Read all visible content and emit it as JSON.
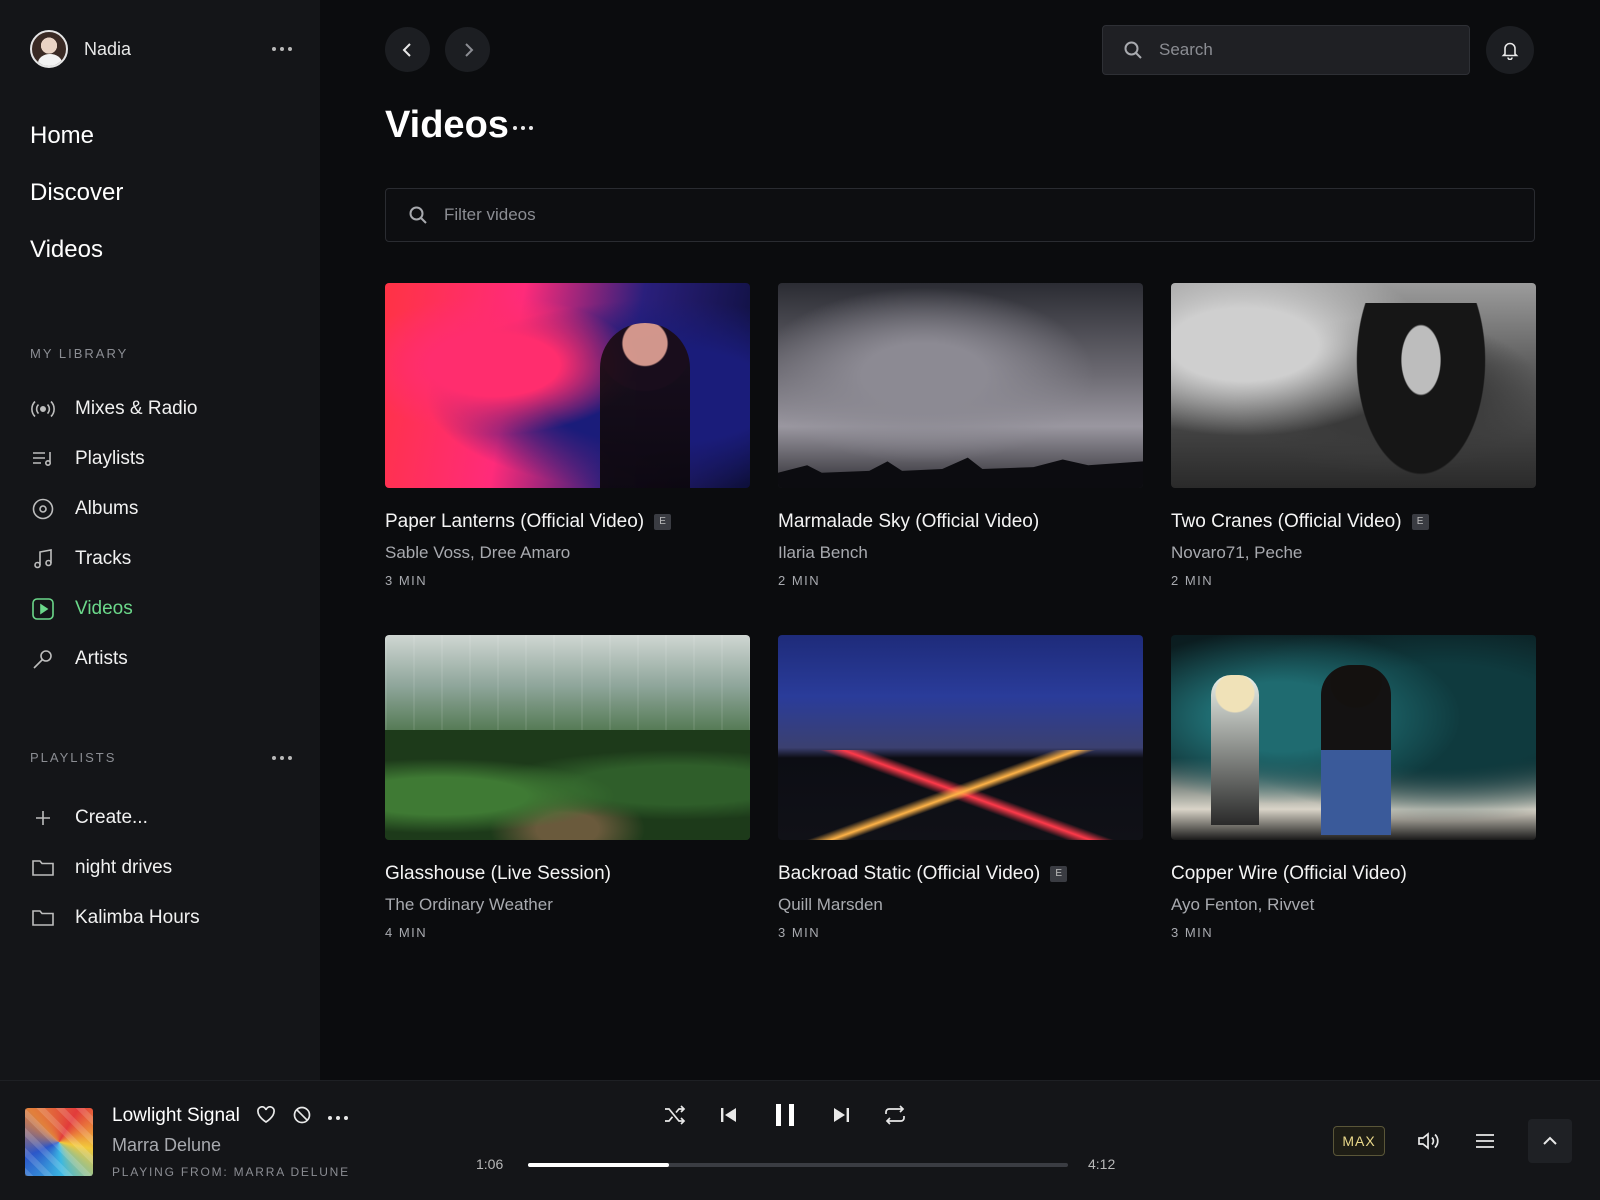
{
  "user": {
    "name": "Nadia"
  },
  "nav": {
    "main": [
      "Home",
      "Discover",
      "Videos"
    ]
  },
  "library": {
    "heading": "MY LIBRARY",
    "items": [
      {
        "label": "Mixes & Radio",
        "icon": "radio-icon"
      },
      {
        "label": "Playlists",
        "icon": "playlist-icon"
      },
      {
        "label": "Albums",
        "icon": "album-icon"
      },
      {
        "label": "Tracks",
        "icon": "music-note-icon"
      },
      {
        "label": "Videos",
        "icon": "video-icon",
        "active": true
      },
      {
        "label": "Artists",
        "icon": "microphone-icon"
      }
    ]
  },
  "playlists": {
    "heading": "PLAYLISTS",
    "items": [
      {
        "label": "Create...",
        "icon": "plus-icon"
      },
      {
        "label": "night drives",
        "icon": "folder-icon"
      },
      {
        "label": "Kalimba Hours",
        "icon": "folder-icon"
      }
    ]
  },
  "header": {
    "search_placeholder": "Search",
    "page_title": "Videos",
    "filter_placeholder": "Filter videos"
  },
  "videos": [
    {
      "title": "Paper Lanterns (Official Video)",
      "explicit": "E",
      "artist": "Sable Voss, Dree Amaro",
      "duration": "3 MIN"
    },
    {
      "title": "Marmalade Sky (Official Video)",
      "explicit": "",
      "artist": "Ilaria Bench",
      "duration": "2 MIN"
    },
    {
      "title": "Two Cranes (Official Video)",
      "explicit": "E",
      "artist": "Novaro71, Peche",
      "duration": "2 MIN"
    },
    {
      "title": "Glasshouse (Live Session)",
      "explicit": "",
      "artist": "The Ordinary Weather",
      "duration": "4 MIN"
    },
    {
      "title": "Backroad Static (Official Video)",
      "explicit": "E",
      "artist": "Quill Marsden",
      "duration": "3 MIN"
    },
    {
      "title": "Copper Wire (Official Video)",
      "explicit": "",
      "artist": "Ayo Fenton, Rivvet",
      "duration": "3 MIN"
    }
  ],
  "player": {
    "title": "Lowlight Signal",
    "artist": "Marra Delune",
    "playing_from": "PLAYING FROM: MARRA DELUNE",
    "elapsed": "1:06",
    "duration": "4:12",
    "progress_fraction": 0.262,
    "quality": "MAX"
  },
  "colors": {
    "accent": "#6bd88a",
    "background": "#0b0c0e",
    "sidebar": "#141518"
  }
}
